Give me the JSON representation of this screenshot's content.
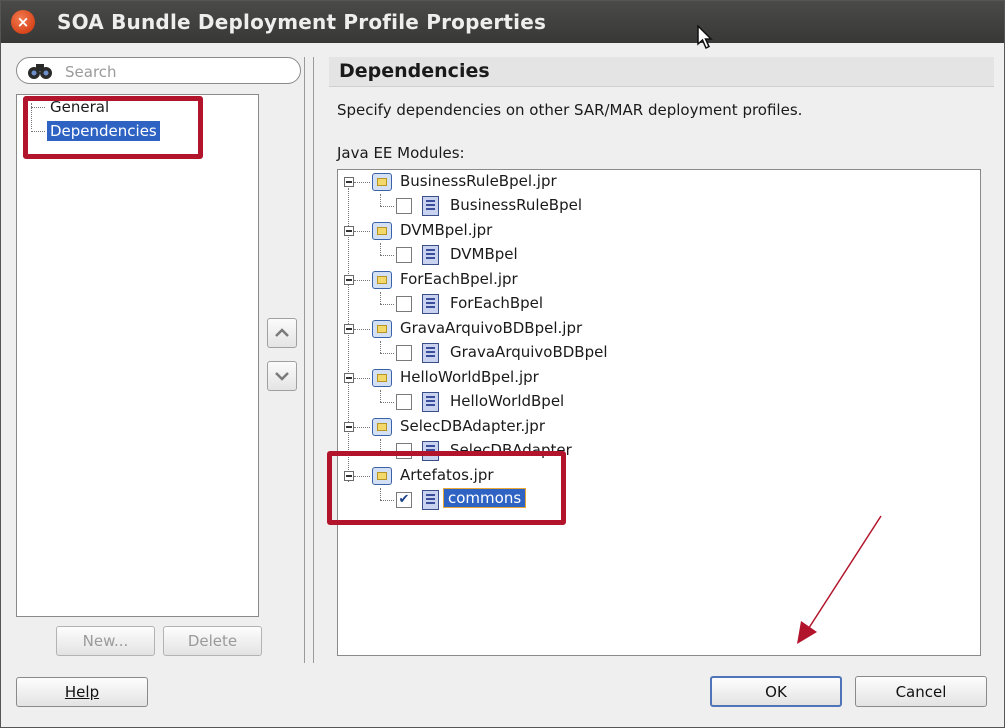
{
  "window": {
    "title": "SOA Bundle Deployment Profile Properties"
  },
  "search": {
    "placeholder": "Search"
  },
  "nav": {
    "items": [
      {
        "label": "General",
        "selected": false
      },
      {
        "label": "Dependencies",
        "selected": true
      }
    ],
    "new_label": "New...",
    "delete_label": "Delete"
  },
  "panel": {
    "title": "Dependencies",
    "description": "Specify dependencies on other SAR/MAR deployment profiles.",
    "modules_label": "Java EE Modules:"
  },
  "tree": [
    {
      "project": "BusinessRuleBpel.jpr",
      "child": "BusinessRuleBpel",
      "checked": false
    },
    {
      "project": "DVMBpel.jpr",
      "child": "DVMBpel",
      "checked": false
    },
    {
      "project": "ForEachBpel.jpr",
      "child": "ForEachBpel",
      "checked": false
    },
    {
      "project": "GravaArquivoBDBpel.jpr",
      "child": "GravaArquivoBDBpel",
      "checked": false
    },
    {
      "project": "HelloWorldBpel.jpr",
      "child": "HelloWorldBpel",
      "checked": false
    },
    {
      "project": "SelecDBAdapter.jpr",
      "child": "SelecDBAdapter",
      "checked": false
    },
    {
      "project": "Artefatos.jpr",
      "child": "commons",
      "checked": true
    }
  ],
  "buttons": {
    "help": "Help",
    "ok": "OK",
    "cancel": "Cancel"
  },
  "colors": {
    "highlight": "#b2152b",
    "selection": "#2e63c4",
    "arrow": "#b2152b"
  }
}
